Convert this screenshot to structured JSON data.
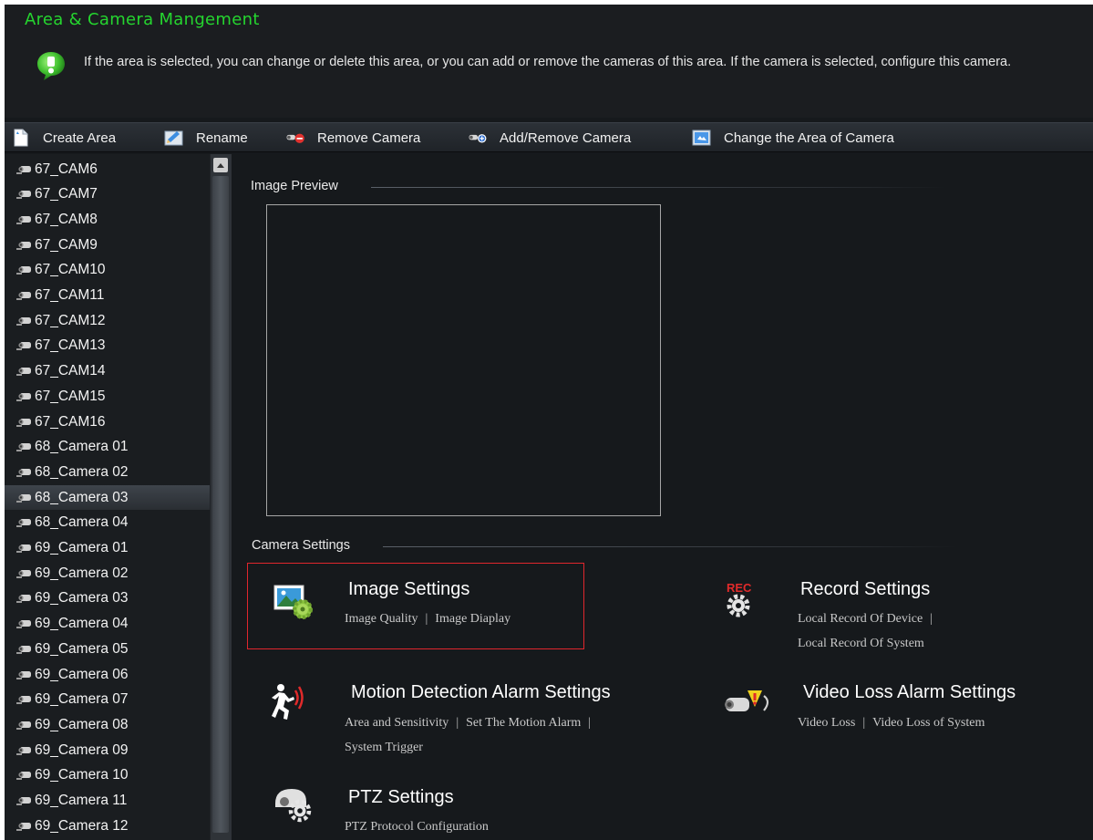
{
  "header": {
    "title": "Area & Camera Mangement",
    "info": "If the area is selected, you can change or delete this area, or you can add or remove the cameras of this area. If the camera is selected, configure this camera."
  },
  "toolbar": {
    "create_area": "Create Area",
    "rename": "Rename",
    "remove_camera": "Remove Camera",
    "add_remove_camera": "Add/Remove Camera",
    "change_area": "Change the Area of Camera"
  },
  "tree": {
    "items": [
      "67_CAM6",
      "67_CAM7",
      "67_CAM8",
      "67_CAM9",
      "67_CAM10",
      "67_CAM11",
      "67_CAM12",
      "67_CAM13",
      "67_CAM14",
      "67_CAM15",
      "67_CAM16",
      "68_Camera 01",
      "68_Camera 02",
      "68_Camera 03",
      "68_Camera 04",
      "69_Camera 01",
      "69_Camera 02",
      "69_Camera 03",
      "69_Camera 04",
      "69_Camera 05",
      "69_Camera 06",
      "69_Camera 07",
      "69_Camera 08",
      "69_Camera 09",
      "69_Camera 10",
      "69_Camera 11",
      "69_Camera 12"
    ],
    "selected": "68_Camera 03"
  },
  "main": {
    "image_preview_label": "Image Preview",
    "camera_settings_label": "Camera Settings",
    "image_settings": {
      "title": "Image Settings",
      "links": [
        "Image Quality",
        "Image Diaplay"
      ]
    },
    "record_settings": {
      "title": "Record Settings",
      "link1": "Local Record Of Device",
      "link2": "Local Record Of System",
      "icon_text": "REC"
    },
    "motion_settings": {
      "title": "Motion Detection Alarm Settings",
      "link1": "Area and Sensitivity",
      "link2": "Set The Motion Alarm",
      "link3": "System Trigger"
    },
    "video_loss_settings": {
      "title": "Video Loss Alarm Settings",
      "links": [
        "Video Loss",
        "Video Loss of System"
      ]
    },
    "ptz_settings": {
      "title": "PTZ Settings",
      "link": "PTZ Protocol Configuration"
    }
  },
  "colors": {
    "title_green": "#25d52f",
    "background": "#16191c",
    "highlight_red": "#e0262d"
  }
}
